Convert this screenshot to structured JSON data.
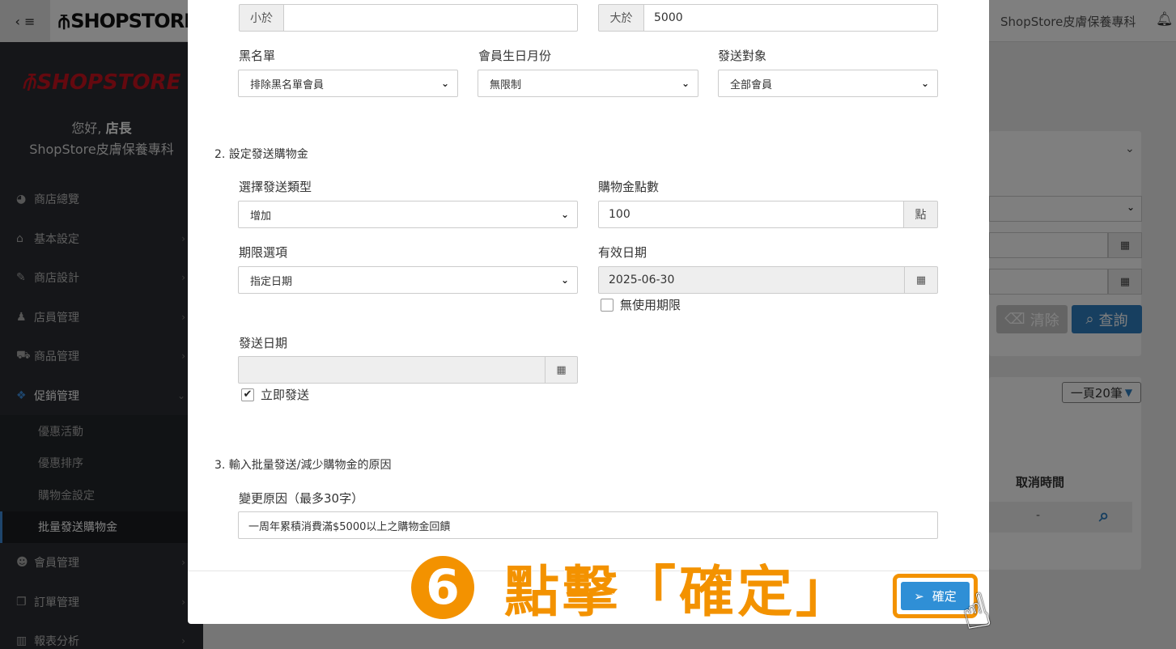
{
  "topbar": {
    "menu_toggle": "‹ ≡",
    "logo_text": "SHOPSTORE",
    "shop_name": "ShopStore皮膚保養專科"
  },
  "sidebar": {
    "brand": "SHOPSTORE",
    "greeting_prefix": "您好, ",
    "greeting_user": "店長",
    "shop_name": "ShopStore皮膚保養專科",
    "items": [
      {
        "label": "商店總覽",
        "icon": "dashboard-icon"
      },
      {
        "label": "基本設定",
        "icon": "bank-icon"
      },
      {
        "label": "商店設計",
        "icon": "magic-wand-icon"
      },
      {
        "label": "店員管理",
        "icon": "user-secret-icon"
      },
      {
        "label": "商品管理",
        "icon": "cart-icon"
      },
      {
        "label": "促銷管理",
        "icon": "gift-icon"
      },
      {
        "label": "會員管理",
        "icon": "users-icon"
      },
      {
        "label": "訂單管理",
        "icon": "copy-icon"
      },
      {
        "label": "報表分析",
        "icon": "bar-chart-icon"
      }
    ],
    "promo_sub": [
      "優惠活動",
      "優惠排序",
      "購物金設定",
      "批量發送購物金"
    ]
  },
  "background": {
    "clear_label": "清除",
    "query_label": "查詢",
    "per_page": "一頁20筆",
    "col_cancel_time": "取消時間",
    "cell_dash": "-"
  },
  "modal": {
    "less_than_label": "小於",
    "less_than_value": "",
    "greater_than_label": "大於",
    "greater_than_value": "5000",
    "blacklist_label": "黑名單",
    "blacklist_value": "排除黑名單會員",
    "birthday_label": "會員生日月份",
    "birthday_value": "無限制",
    "target_label": "發送對象",
    "target_value": "全部會員",
    "section2": "2. 設定發送購物金",
    "send_type_label": "選擇發送類型",
    "send_type_value": "增加",
    "points_label": "購物金點數",
    "points_value": "100",
    "points_unit": "點",
    "period_label": "期限選項",
    "period_value": "指定日期",
    "expiry_label": "有效日期",
    "expiry_value": "2025-06-30",
    "no_limit_label": "無使用期限",
    "no_limit_checked": false,
    "send_date_label": "發送日期",
    "send_date_value": "",
    "send_now_label": "立即發送",
    "send_now_checked": true,
    "section3": "3. 輸入批量發送/減少購物金的原因",
    "reason_label": "變更原因（最多30字）",
    "reason_value": "一周年累積消費滿$5000以上之購物金回饋",
    "confirm_label": "確定"
  },
  "annotation": {
    "step_number": "6",
    "text": "點擊「確定」"
  },
  "colors": {
    "accent_orange": "#f39200",
    "primary_blue": "#2f8fd6",
    "sidebar_bg": "#2a2d32",
    "brand_red": "#c9121e"
  }
}
